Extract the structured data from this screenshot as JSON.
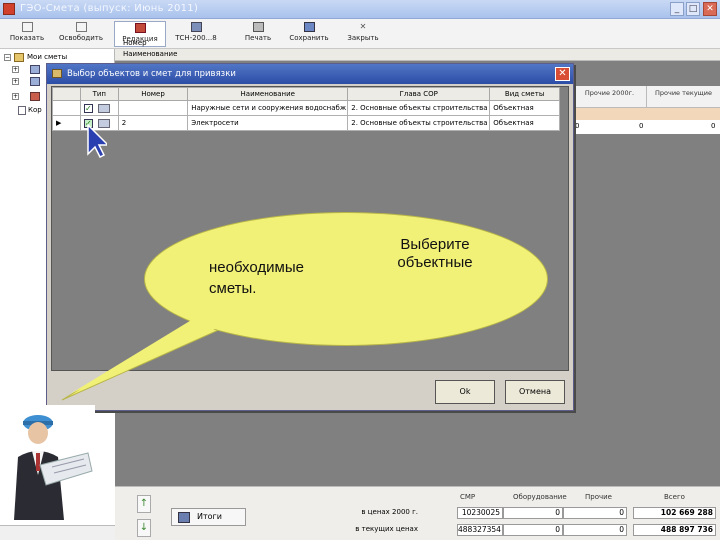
{
  "window": {
    "title": "ГЭО-Смета (выпуск: Июнь 2011)",
    "min": "_",
    "max": "□",
    "close": "✕"
  },
  "toolbar": [
    {
      "label": "Показать",
      "icon": "page-icon"
    },
    {
      "label": "Освободить",
      "icon": "page-icon"
    },
    {
      "label": "Редакция",
      "icon": "edit-icon"
    },
    {
      "label": "ТСН-200...8",
      "icon": "tree-icon"
    },
    {
      "label": "Печать",
      "icon": "printer-icon"
    },
    {
      "label": "Сохранить",
      "icon": "save-icon"
    },
    {
      "label": "Закрыть",
      "icon": "close-icon"
    }
  ],
  "tree": {
    "items": [
      "Мои сметы",
      "",
      "",
      "",
      "Кор"
    ]
  },
  "grid_head": {
    "number": "Номер",
    "name": "Наименование"
  },
  "right_table": {
    "headers": [
      "Прочие 2000г.",
      "Прочие текущие"
    ],
    "values": [
      "0",
      "0"
    ],
    "left_value": "0"
  },
  "dialog": {
    "title": "Выбор объектов и смет для привязки",
    "columns": [
      "",
      "Тип",
      "Номер",
      "Наименование",
      "Глава СОР",
      "Вид сметы"
    ],
    "rows": [
      {
        "marker": "",
        "checked": true,
        "number": "",
        "name": "Наружные сети и сооружения водоснабж",
        "chapter": "2. Основные объекты строительства",
        "type": "Объектная"
      },
      {
        "marker": "▶",
        "checked": true,
        "number": "2",
        "name": "Электросети",
        "chapter": "2. Основные объекты строительства",
        "type": "Объектная"
      }
    ],
    "ok": "Ok",
    "cancel": "Отмена"
  },
  "callout": {
    "line1": "Выберите объектные",
    "line2": "необходимые сметы."
  },
  "bottom": {
    "itogi": "Итоги",
    "headers": [
      "СМР",
      "Оборудование",
      "Прочие",
      "Всего"
    ],
    "rows": [
      {
        "label": "в ценах 2000 г.",
        "values": [
          "10230025",
          "0",
          "0",
          "102 669 288"
        ]
      },
      {
        "label": "в текущих ценах",
        "values": [
          "488327354",
          "0",
          "0",
          "488 897 736"
        ]
      }
    ],
    "up": "↑",
    "down": "↓"
  },
  "colors": {
    "dialog_title": "#2b4da6",
    "bubble": "#f1f077",
    "grid_bg": "#808080"
  }
}
